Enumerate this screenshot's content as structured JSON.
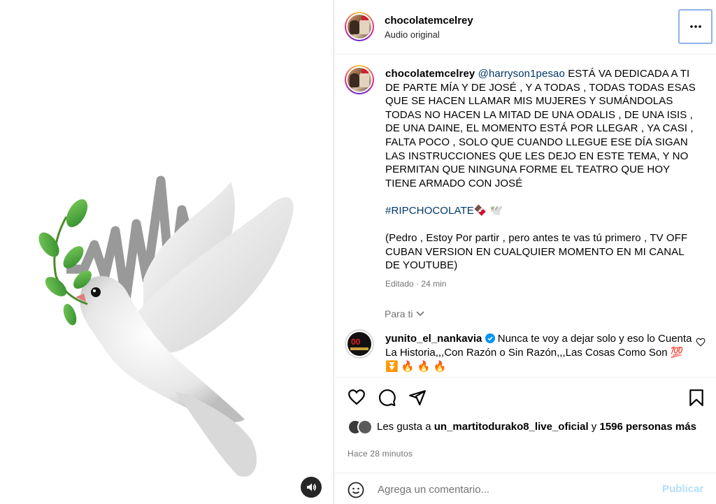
{
  "post": {
    "username": "chocolatemcelrey",
    "audio_label": "Audio original"
  },
  "caption": {
    "username": "chocolatemcelrey",
    "mention": "@harryson1pesao",
    "text_line1": " ESTÁ VA DEDICADA A TI DE PARTE MÍA Y DE JOSÉ , Y A TODAS , TODAS TODAS ESAS QUE SE HACEN LLAMAR MIS MUJERES Y SUMÁNDOLAS TODAS NO HACEN LA MITAD DE UNA ODALIS , DE UNA ISIS , DE UNA DAINE, EL MOMENTO ESTÁ POR LLEGAR , YA CASI , FALTA POCO , SOLO QUE CUANDO LLEGUE ESE DÍA SIGAN LAS INSTRUCCIONES QUE LES DEJO EN ESTE TEMA, Y NO PERMITAN QUE NINGUNA FORME EL TEATRO QUE HOY TIENE ARMADO CON JOSÉ",
    "hashtag": "#RIPCHOCOLATE",
    "hashtag_emoji": "🍫 🕊️",
    "text_line2": "(Pedro , Estoy Por partir , pero antes te vas tú primero , TV OFF CUBAN VERSION EN CUALQUIER MOMENTO EN MI CANAL DE YOUTUBE)",
    "edited": "Editado",
    "dot": "·",
    "edited_time": "24 min"
  },
  "sort_label": "Para ti",
  "comment": {
    "username": "yunito_el_nankavia",
    "text": " Nunca te voy a dejar solo y eso lo Cuenta La Historia,,,Con Razón o Sin Razón,,,Las Cosas Como Son 💯 ⏬ 🔥 🔥 🔥"
  },
  "likes": {
    "prefix": "Les gusta a ",
    "user": "un_martitodurako8_live_oficial",
    "middle": " y ",
    "count": "1596 personas más"
  },
  "timestamp": "Hace 28 minutos",
  "add_comment": {
    "placeholder": "Agrega un comentario...",
    "publish_label": "Publicar"
  },
  "colors": {
    "link": "#00376b",
    "muted": "#737373",
    "publish_disabled": "#b2dffc",
    "verified": "#0095f6"
  },
  "icons": [
    "more-icon",
    "heart-icon",
    "comment-icon",
    "share-icon",
    "bookmark-icon",
    "emoji-icon",
    "speaker-icon",
    "chevron-down-icon",
    "verified-icon"
  ]
}
